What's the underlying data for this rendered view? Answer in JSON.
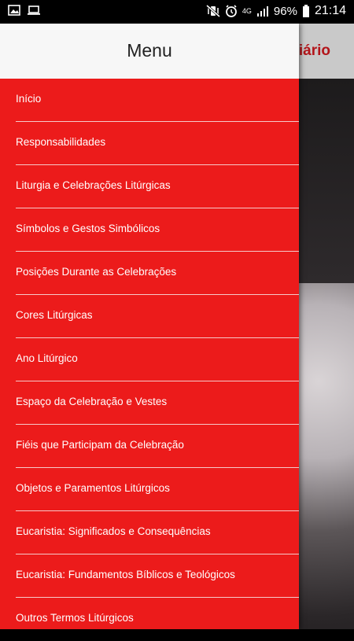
{
  "status_bar": {
    "battery_percent": "96%",
    "time": "21:14",
    "network": "4G"
  },
  "app": {
    "title_partial": "iário"
  },
  "drawer": {
    "title": "Menu",
    "items": [
      {
        "label": "Início"
      },
      {
        "label": "Responsabilidades"
      },
      {
        "label": "Liturgia e Celebrações Litúrgicas"
      },
      {
        "label": "Símbolos e Gestos Simbólicos"
      },
      {
        "label": "Posições Durante as Celebrações"
      },
      {
        "label": "Cores Litúrgicas"
      },
      {
        "label": "Ano Litúrgico"
      },
      {
        "label": "Espaço da Celebração e Vestes"
      },
      {
        "label": "Fiéis que Participam da Celebração"
      },
      {
        "label": "Objetos e Paramentos Litúrgicos"
      },
      {
        "label": "Eucaristia: Significados e Consequências"
      },
      {
        "label": "Eucaristia: Fundamentos Bíblicos e Teológicos"
      },
      {
        "label": "Outros Termos Litúrgicos"
      }
    ]
  },
  "colors": {
    "drawer_bg": "#ec1b1b",
    "header_bg": "#f7f7f7",
    "app_title": "#b3151a"
  }
}
